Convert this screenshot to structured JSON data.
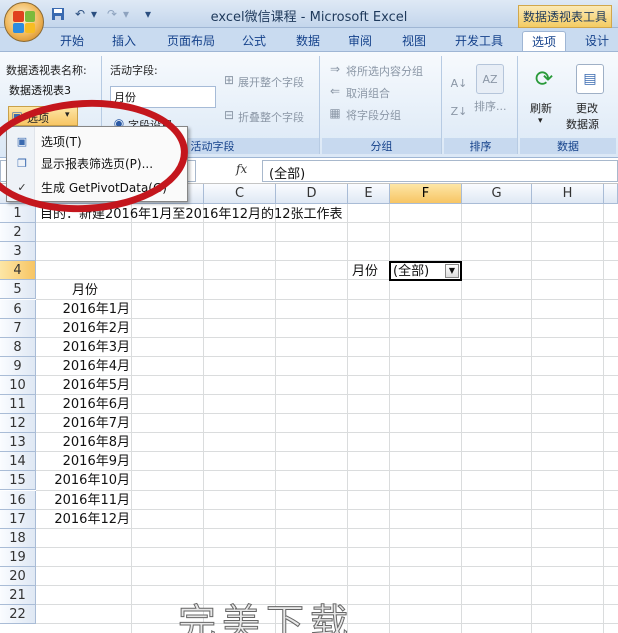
{
  "titlebar": {
    "app_title": "excel微信课程 - Microsoft Excel",
    "context_title": "数据透视表工具",
    "undo_icon": "undo-icon",
    "redo_icon": "redo-icon",
    "save_icon": "save-icon"
  },
  "tabs": [
    "开始",
    "插入",
    "页面布局",
    "公式",
    "数据",
    "审阅",
    "视图",
    "开发工具",
    "选项",
    "设计"
  ],
  "active_tab": "选项",
  "ribbon": {
    "pivot_name_label": "数据透视表名称:",
    "pivot_name_value": "数据透视表3",
    "options_button": "选项",
    "active_field_label": "活动字段:",
    "active_field_value": "月份",
    "field_settings": "字段设置",
    "expand_field": "展开整个字段",
    "collapse_field": "折叠整个字段",
    "active_field_group": "活动字段",
    "group_selection": "将所选内容分组",
    "ungroup": "取消组合",
    "group_field": "将字段分组",
    "group_group": "分组",
    "sort_button": "排序...",
    "sort_group": "排序",
    "refresh": "刷新",
    "change_source_line1": "更改",
    "change_source_line2": "数据源",
    "data_group": "数据"
  },
  "menu": {
    "items": [
      "选项(T)",
      "显示报表筛选页(P)...",
      "生成 GetPivotData(G)"
    ]
  },
  "formula_bar": {
    "fx": "fx",
    "content": "(全部)"
  },
  "grid": {
    "columns": [
      "A",
      "B",
      "C",
      "D",
      "E",
      "F",
      "G",
      "H"
    ],
    "selected_column": "F",
    "selected_row": "4",
    "rows": [
      "1",
      "2",
      "3",
      "4",
      "5",
      "6",
      "7",
      "8",
      "9",
      "10",
      "11",
      "12",
      "13",
      "14",
      "15",
      "16",
      "17",
      "18",
      "19",
      "20",
      "21",
      "22"
    ],
    "a1": "目的：新建2016年1月至2016年12月的12张工作表",
    "e4": "月份",
    "f4": "(全部)",
    "a5": "月份",
    "months": [
      "2016年1月",
      "2016年2月",
      "2016年3月",
      "2016年4月",
      "2016年5月",
      "2016年6月",
      "2016年7月",
      "2016年8月",
      "2016年9月",
      "2016年10月",
      "2016年11月",
      "2016年12月"
    ]
  },
  "watermark": "完美下载",
  "colors": {
    "accent": "#c4161d",
    "ribbon_blue": "#15428b",
    "selection_orange": "#f7c564"
  }
}
